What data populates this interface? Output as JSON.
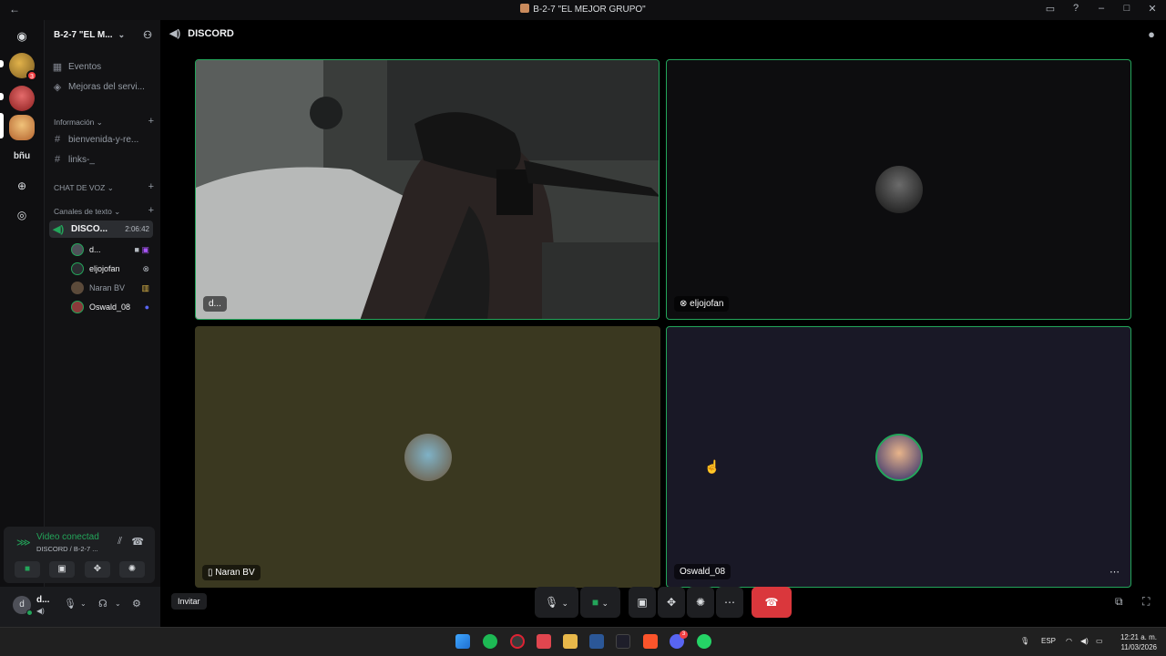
{
  "window": {
    "title": "B-2-7 \"EL MEJOR GRUPO\""
  },
  "server": {
    "name": "B-2-7 \"EL M..."
  },
  "sidebar": {
    "items": [
      {
        "label": "Eventos",
        "icon": "calendar-icon"
      },
      {
        "label": "Mejoras del servi...",
        "icon": "boost-icon"
      }
    ],
    "categories": {
      "informacion": "Información",
      "chat_de_voz": "CHAT DE VOZ",
      "canales_de_texto": "Canales de texto"
    },
    "text_channels": [
      {
        "label": "bienvenida-y-re..."
      },
      {
        "label": "links-_"
      }
    ],
    "voice_channel": {
      "label": "DISCO...",
      "timer": "2:06:42"
    },
    "voice_users": [
      {
        "name": "d...",
        "color": "#4e5058"
      },
      {
        "name": "eljojofan",
        "color": "#2b2d31"
      },
      {
        "name": "Naran BV",
        "color": "#5b4a3a"
      },
      {
        "name": "Oswald_08",
        "color": "#8a3a3a"
      }
    ]
  },
  "guild_rail": {
    "badge_count": "3",
    "text_label": "bñu"
  },
  "rtc_panel": {
    "status": "Video conectad",
    "subtitle": "DISCORD / B-2-7 ..."
  },
  "user_panel": {
    "name": "d...",
    "avatar_letter": "d"
  },
  "main": {
    "channel_name": "DISCORD",
    "invite_label": "Invitar"
  },
  "tiles": [
    {
      "label": "d...",
      "bg": "#2a2c2a"
    },
    {
      "label": "eljojofan",
      "bg": "#0d0d0f"
    },
    {
      "label": "Naran BV",
      "bg": "#3a3820"
    },
    {
      "label": "Oswald_08",
      "bg": "#191826"
    }
  ],
  "taskbar": {
    "lang": "ESP",
    "time": "12:21 a. m.",
    "date": "11/03/2026",
    "discord_badge": "3"
  },
  "colors": {
    "accent_green": "#23a55a",
    "danger_red": "#da373c",
    "tile_border_active": "#23a55a"
  }
}
